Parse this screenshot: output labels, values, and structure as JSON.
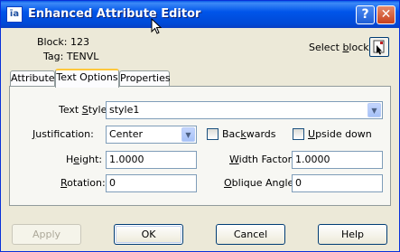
{
  "window": {
    "title": "Enhanced Attribute Editor",
    "app_icon": "ia-app-icon",
    "help_glyph": "?",
    "close_glyph": "✕"
  },
  "header": {
    "block_label": "Block:",
    "block_value": "123",
    "tag_label": "Tag:",
    "tag_value": "TENVL",
    "select_block_label": "Select block"
  },
  "tabs": [
    {
      "label": "Attribute",
      "active": false
    },
    {
      "label": "Text Options",
      "active": true
    },
    {
      "label": "Properties",
      "active": false
    }
  ],
  "text_options": {
    "text_style_label": "Text Style:",
    "text_style_value": "style1",
    "justification_label": "Justification:",
    "justification_value": "Center",
    "backwards_label": "Backwards",
    "backwards_checked": false,
    "upside_down_label": "Upside down",
    "upside_down_checked": false,
    "height_label": "Height:",
    "height_value": "1.0000",
    "width_factor_label": "Width Factor:",
    "width_factor_value": "1.0000",
    "rotation_label": "Rotation:",
    "rotation_value": "0",
    "oblique_angle_label": "Oblique Angle:",
    "oblique_angle_value": "0"
  },
  "buttons": {
    "apply": "Apply",
    "ok": "OK",
    "cancel": "Cancel",
    "help": "Help"
  }
}
